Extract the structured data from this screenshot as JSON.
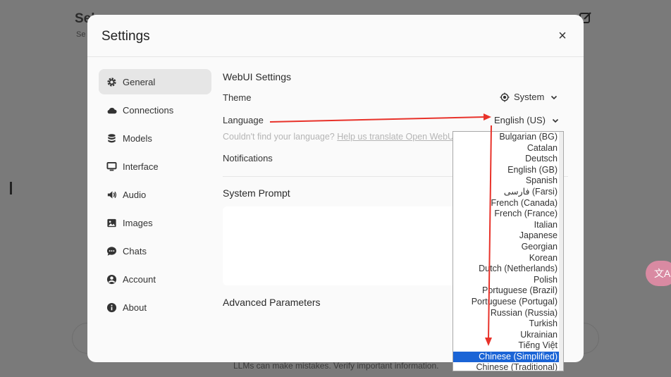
{
  "background": {
    "title": "Sel",
    "subtitle": "Se",
    "footer": "LLMs can make mistakes. Verify important information.",
    "translate_badge": "文A"
  },
  "modal": {
    "title": "Settings",
    "close_label": "×"
  },
  "sidebar": {
    "items": [
      {
        "label": "General",
        "icon": "gear-icon"
      },
      {
        "label": "Connections",
        "icon": "cloud-icon"
      },
      {
        "label": "Models",
        "icon": "database-icon"
      },
      {
        "label": "Interface",
        "icon": "monitor-icon"
      },
      {
        "label": "Audio",
        "icon": "speaker-icon"
      },
      {
        "label": "Images",
        "icon": "image-icon"
      },
      {
        "label": "Chats",
        "icon": "chat-icon"
      },
      {
        "label": "Account",
        "icon": "user-icon"
      },
      {
        "label": "About",
        "icon": "info-icon"
      }
    ]
  },
  "general": {
    "section_title": "WebUI Settings",
    "theme_label": "Theme",
    "theme_value": "System",
    "language_label": "Language",
    "language_value": "English (US)",
    "hint_text": "Couldn't find your language?",
    "hint_link": "Help us translate Open WebUI!",
    "notifications_label": "Notifications",
    "system_prompt_title": "System Prompt",
    "advanced_title": "Advanced Parameters"
  },
  "language_options": [
    "Bulgarian (BG)",
    "Catalan",
    "Deutsch",
    "English (GB)",
    "Spanish",
    "فارسی (Farsi)",
    "French (Canada)",
    "French (France)",
    "Italian",
    "Japanese",
    "Georgian",
    "Korean",
    "Dutch (Netherlands)",
    "Polish",
    "Portuguese (Brazil)",
    "Portuguese (Portugal)",
    "Russian (Russia)",
    "Turkish",
    "Ukrainian",
    "Tiếng Việt",
    "Chinese (Simplified)",
    "Chinese (Traditional)"
  ],
  "selected_language": "Chinese (Simplified)",
  "colors": {
    "selection": "#1a64d6",
    "annotation_arrow": "#e8322a",
    "send_button": "#0e7a4e"
  }
}
